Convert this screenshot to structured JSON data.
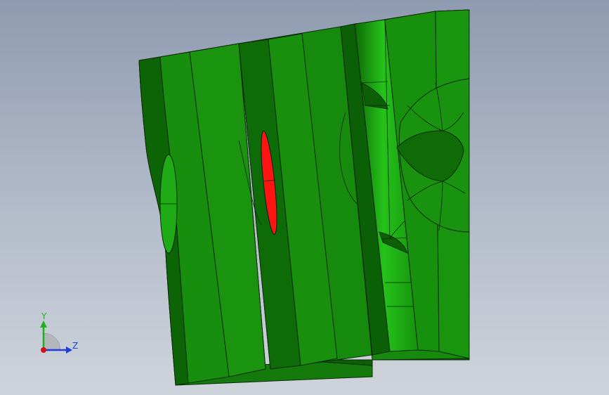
{
  "viewport": {
    "background_top": "#8f9bb0",
    "background_bottom": "#cfd4dc"
  },
  "model": {
    "body_color": "#1a8a0f",
    "dark_color": "#0a5e06",
    "highlight_color": "#22b819",
    "selected_face_color": "#ff1a1a",
    "edge_color": "#0b2b07"
  },
  "triad": {
    "y_label": "Y",
    "z_label": "Z",
    "y_color": "#1db31d",
    "z_color": "#1f3fd6",
    "x_color": "#d41414"
  }
}
